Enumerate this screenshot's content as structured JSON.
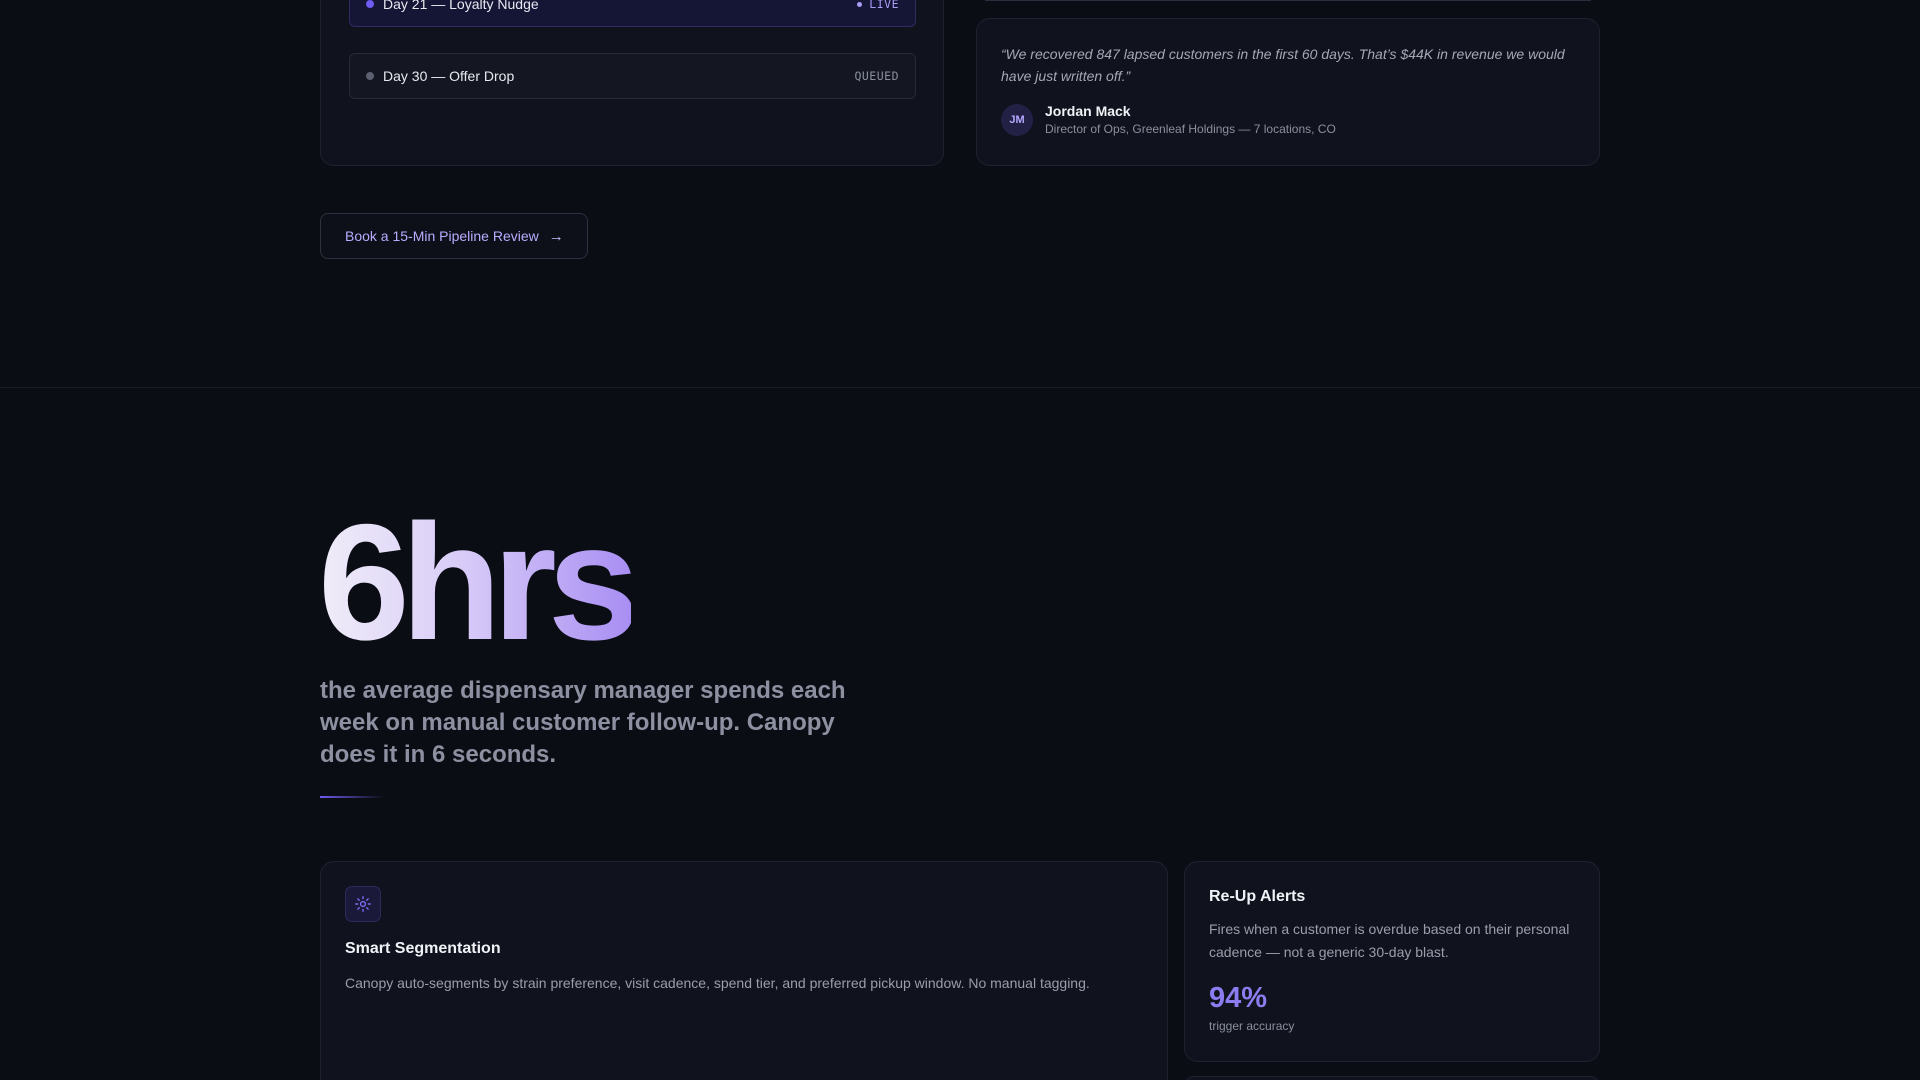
{
  "pipeline": {
    "steps": [
      {
        "label": "Day 21 — Loyalty Nudge",
        "status": "LIVE"
      },
      {
        "label": "Day 30 — Offer Drop",
        "status": "QUEUED"
      }
    ]
  },
  "testimonial": {
    "quote": "“We recovered 847 lapsed customers in the first 60 days. That’s $44K in revenue we would have just written off.”",
    "initials": "JM",
    "name": "Jordan Mack",
    "role": "Director of Ops, Greenleaf Holdings — 7 locations, CO"
  },
  "cta": {
    "label": "Book a 15-Min Pipeline Review",
    "arrow": "→"
  },
  "hero": {
    "stat": "6hrs",
    "caption": "the average dispensary manager spends each week on manual customer follow-up. Canopy does it in 6 seconds."
  },
  "features": {
    "segmentation": {
      "icon": "gear-icon",
      "title": "Smart Segmentation",
      "description": "Canopy auto-segments by strain preference, visit cadence, spend tier, and preferred pickup window. No manual tagging."
    },
    "alerts": {
      "title": "Re-Up Alerts",
      "description": "Fires when a customer is overdue based on their personal cadence — not a generic 30-day blast.",
      "metric_value": "94%",
      "metric_label": "trigger accuracy"
    }
  },
  "colors": {
    "background": "#0b0d14",
    "card": "#10131d",
    "accent": "#6d5cf0",
    "accent_light": "#a99cf4"
  }
}
